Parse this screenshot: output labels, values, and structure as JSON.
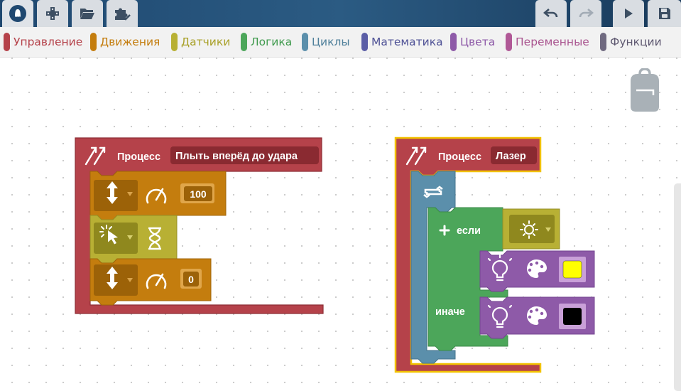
{
  "toolbar": {
    "left_buttons": [
      "logo-button",
      "gamepad-button",
      "open-folder-button",
      "extensions-button"
    ],
    "right_buttons": [
      "undo-button",
      "redo-button",
      "run-button",
      "save-button"
    ]
  },
  "categories": [
    {
      "label": "Управление",
      "color": "#b5424a"
    },
    {
      "label": "Движения",
      "color": "#c47d0e"
    },
    {
      "label": "Датчики",
      "color": "#b8b034"
    },
    {
      "label": "Логика",
      "color": "#4ca65a"
    },
    {
      "label": "Циклы",
      "color": "#5b8fab"
    },
    {
      "label": "Математика",
      "color": "#5b5ea6"
    },
    {
      "label": "Цвета",
      "color": "#8e5aa8"
    },
    {
      "label": "Переменные",
      "color": "#b05896"
    },
    {
      "label": "Функции",
      "color": "#706a80"
    }
  ],
  "process1": {
    "keyword": "Процесс",
    "name": "Плыть вперёд до удара",
    "speed1": "100",
    "speed2": "0"
  },
  "process2": {
    "keyword": "Процесс",
    "name": "Лазер",
    "if_label": "если",
    "else_label": "иначе",
    "color_if": "#ffff00",
    "color_else": "#000000"
  },
  "colors": {
    "control": "#b5424a",
    "motion": "#c47d0e",
    "sensor": "#b8b034",
    "logic": "#4ca65a",
    "loop": "#5b8fab",
    "color": "#8e5aa8",
    "highlight": "#f2c200"
  }
}
